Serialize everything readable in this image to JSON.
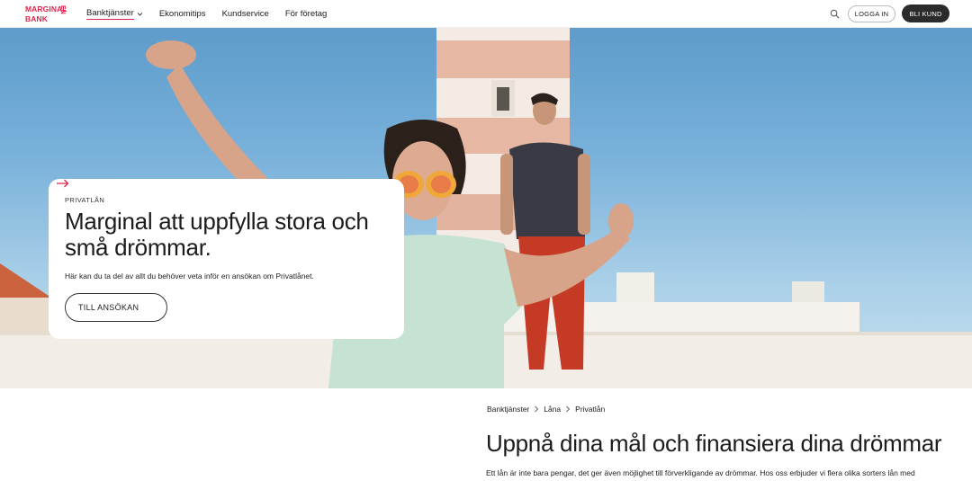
{
  "brand": {
    "line1": "MARGINAL",
    "line2": "BANK",
    "suffix": "EN",
    "color": "#e0234e"
  },
  "nav": {
    "items": [
      {
        "label": "Banktjänster",
        "has_dropdown": true,
        "active": true
      },
      {
        "label": "Ekonomitips"
      },
      {
        "label": "Kundservice"
      },
      {
        "label": "För företag"
      }
    ]
  },
  "header_actions": {
    "search_icon": "search-icon",
    "login_label": "LOGGA IN",
    "join_label": "BLI KUND"
  },
  "hero": {
    "kicker": "PRIVATLÅN",
    "title": "Marginal att uppfylla stora och små drömmar.",
    "lead": "Här kan du ta del av allt du behöver veta inför en ansökan om Privatlånet.",
    "cta_label": "TILL ANSÖKAN",
    "cta_icon": "arrow-right-icon"
  },
  "breadcrumb": [
    "Banktjänster",
    "Låna",
    "Privatlån"
  ],
  "content": {
    "title": "Uppnå dina mål och finansiera dina drömmar",
    "intro": "Ett lån är inte bara pengar, det ger även möjlighet till förverkligande av drömmar. Hos oss erbjuder vi flera olika sorters lån med"
  }
}
